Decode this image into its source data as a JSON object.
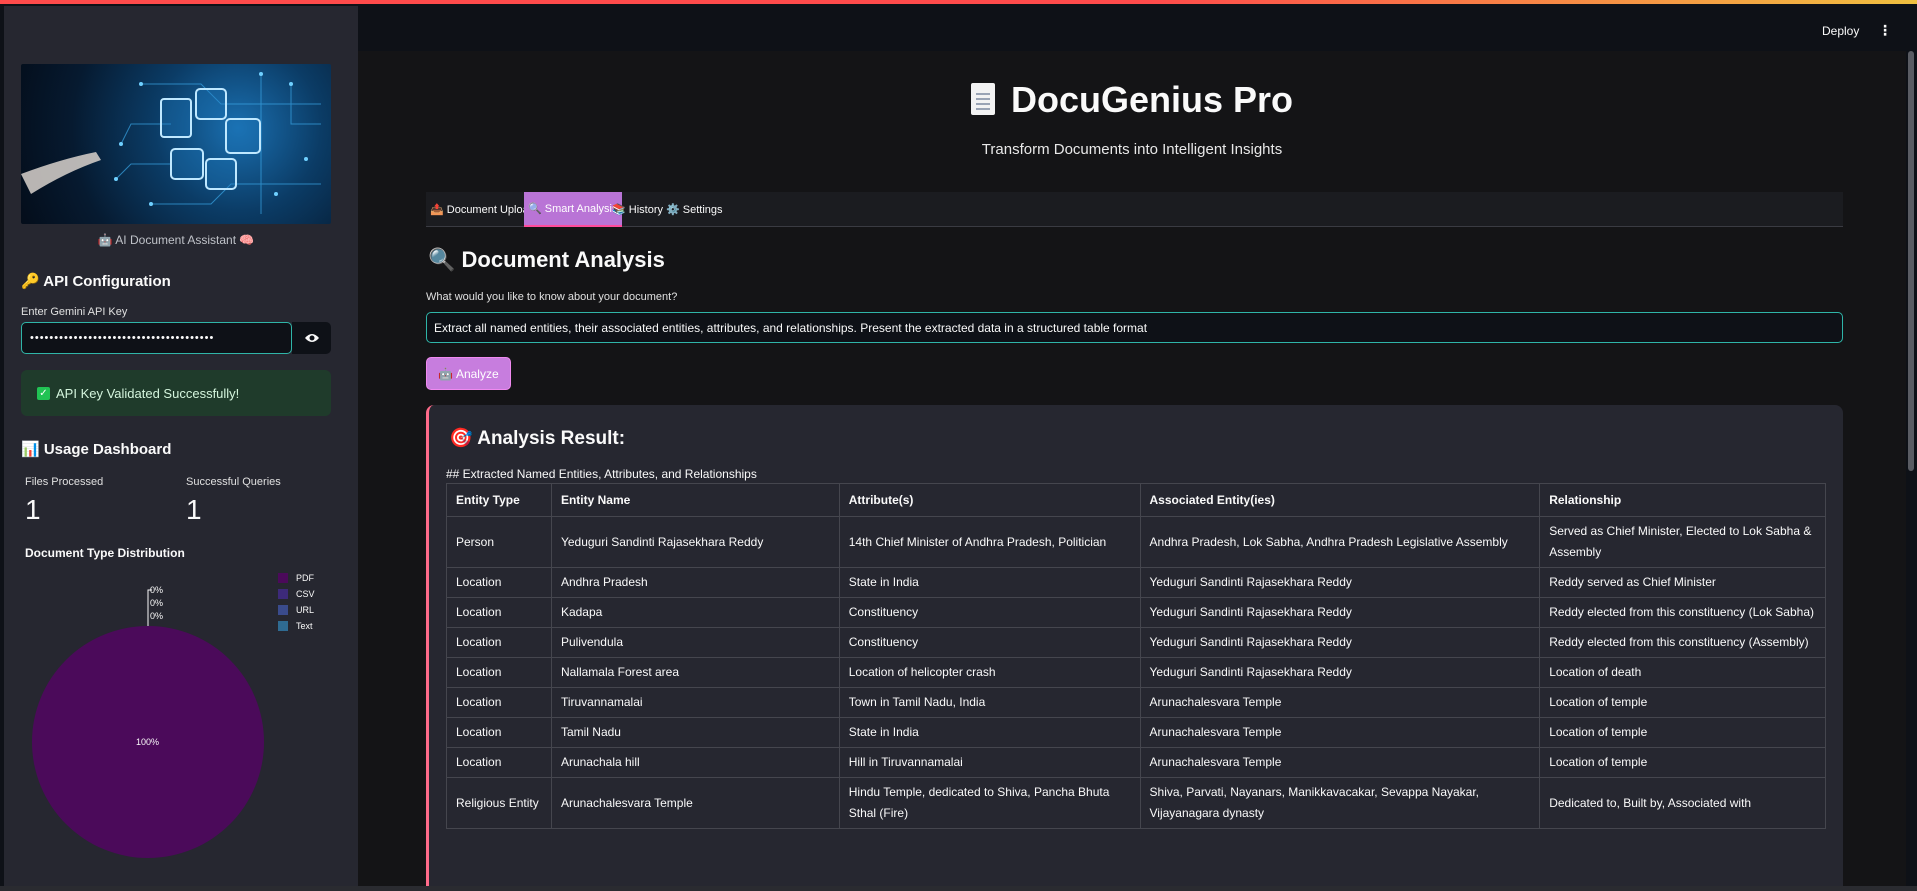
{
  "sidebar": {
    "caption": "🤖 AI Document Assistant 🧠",
    "api_heading": "🔑 API Configuration",
    "api_label": "Enter Gemini API Key",
    "api_value": "••••••••••••••••••••••••••••••••••••••",
    "success_message": "API Key Validated Successfully!",
    "usage_heading": "📊 Usage Dashboard",
    "metrics": [
      {
        "label": "Files Processed",
        "value": "1"
      },
      {
        "label": "Successful Queries",
        "value": "1"
      }
    ],
    "chart_title": "Document Type Distribution"
  },
  "chart_data": {
    "type": "pie",
    "title": "Document Type Distribution",
    "categories": [
      "PDF",
      "CSV",
      "URL",
      "Text"
    ],
    "values": [
      100,
      0,
      0,
      0
    ],
    "labels": [
      "100%",
      "0%",
      "0%",
      "0%"
    ],
    "colors": [
      "#4b0a5a",
      "#3d2a7a",
      "#3a4b8c",
      "#2f6b92"
    ],
    "legend": "top-right"
  },
  "header": {
    "deploy_label": "Deploy",
    "menu_icon": "more-vertical-icon"
  },
  "main": {
    "title": "DocuGenius Pro",
    "subtitle": "Transform Documents into Intelligent Insights",
    "tabs": [
      {
        "label": "📤 Document Upload",
        "active": false
      },
      {
        "label": "🔍 Smart Analysis",
        "active": true
      },
      {
        "label": "📚 History",
        "active": false
      },
      {
        "label": "⚙️ Settings",
        "active": false
      }
    ],
    "section_heading": "🔍 Document Analysis",
    "question_label": "What would you like to know about your document?",
    "query_value": "Extract all named entities, their associated entities, attributes, and relationships. Present the extracted data in a structured table format",
    "analyze_label": "🤖 Analyze",
    "result_heading": "🎯 Analysis Result:",
    "result_subheading": "## Extracted Named Entities, Attributes, and Relationships",
    "table": {
      "headers": [
        "Entity Type",
        "Entity Name",
        "Attribute(s)",
        "Associated Entity(ies)",
        "Relationship"
      ],
      "rows": [
        [
          "Person",
          "Yeduguri Sandinti Rajasekhara Reddy",
          "14th Chief Minister of Andhra Pradesh, Politician",
          "Andhra Pradesh, Lok Sabha, Andhra Pradesh Legislative Assembly",
          "Served as Chief Minister, Elected to Lok Sabha & Assembly"
        ],
        [
          "Location",
          "Andhra Pradesh",
          "State in India",
          "Yeduguri Sandinti Rajasekhara Reddy",
          "Reddy served as Chief Minister"
        ],
        [
          "Location",
          "Kadapa",
          "Constituency",
          "Yeduguri Sandinti Rajasekhara Reddy",
          "Reddy elected from this constituency (Lok Sabha)"
        ],
        [
          "Location",
          "Pulivendula",
          "Constituency",
          "Yeduguri Sandinti Rajasekhara Reddy",
          "Reddy elected from this constituency (Assembly)"
        ],
        [
          "Location",
          "Nallamala Forest area",
          "Location of helicopter crash",
          "Yeduguri Sandinti Rajasekhara Reddy",
          "Location of death"
        ],
        [
          "Location",
          "Tiruvannamalai",
          "Town in Tamil Nadu, India",
          "Arunachalesvara Temple",
          "Location of temple"
        ],
        [
          "Location",
          "Tamil Nadu",
          "State in India",
          "Arunachalesvara Temple",
          "Location of temple"
        ],
        [
          "Location",
          "Arunachala hill",
          "Hill in Tiruvannamalai",
          "Arunachalesvara Temple",
          "Location of temple"
        ],
        [
          "Religious Entity",
          "Arunachalesvara Temple",
          "Hindu Temple, dedicated to Shiva, Pancha Bhuta Sthal (Fire)",
          "Shiva, Parvati, Nayanars, Manikkavacakar, Sevappa Nayakar, Vijayanagara dynasty",
          "Dedicated to, Built by, Associated with"
        ]
      ]
    }
  }
}
